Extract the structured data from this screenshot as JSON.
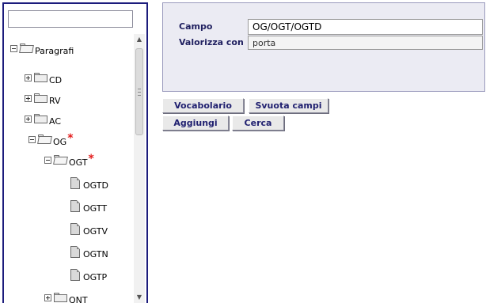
{
  "tree": {
    "search_value": "",
    "nodes": [
      {
        "label": "Paragrafi",
        "kind": "folder-open",
        "toggle": "minus",
        "required": false
      },
      {
        "label": "CD",
        "kind": "folder",
        "toggle": "plus",
        "required": false
      },
      {
        "label": "RV",
        "kind": "folder",
        "toggle": "plus",
        "required": false
      },
      {
        "label": "AC",
        "kind": "folder",
        "toggle": "plus",
        "required": false
      },
      {
        "label": "OG",
        "kind": "folder-open",
        "toggle": "minus",
        "required": true,
        "required_mark": "*"
      },
      {
        "label": "OGT",
        "kind": "folder-open",
        "toggle": "minus",
        "required": true,
        "required_mark": "*"
      },
      {
        "label": "OGTD",
        "kind": "document",
        "toggle": null,
        "required": false
      },
      {
        "label": "OGTT",
        "kind": "document",
        "toggle": null,
        "required": false
      },
      {
        "label": "OGTV",
        "kind": "document",
        "toggle": null,
        "required": false
      },
      {
        "label": "OGTN",
        "kind": "document",
        "toggle": null,
        "required": false
      },
      {
        "label": "OGTP",
        "kind": "document",
        "toggle": null,
        "required": false
      },
      {
        "label": "QNT",
        "kind": "folder",
        "toggle": "plus",
        "required": false
      }
    ]
  },
  "form": {
    "campo_label": "Campo",
    "campo_value": "OG/OGT/OGTD",
    "valorizza_label": "Valorizza con",
    "valorizza_value": "porta"
  },
  "buttons": {
    "vocabolario": "Vocabolario",
    "svuota_campi": "Svuota campi",
    "aggiungi": "Aggiungi",
    "cerca": "Cerca"
  },
  "colors": {
    "panel_border": "#1c1c7c",
    "form_bg": "#ebebf3",
    "button_text": "#1f1f6f",
    "required_star": "#e31b1b"
  }
}
